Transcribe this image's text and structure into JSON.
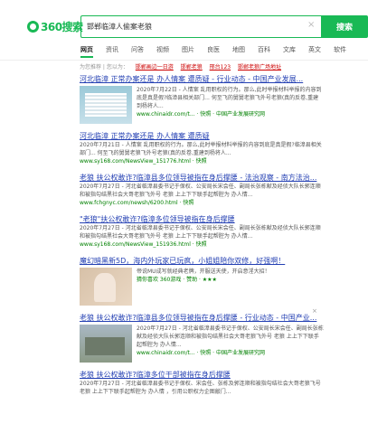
{
  "header": {
    "logo_text": "360搜索",
    "query": "邯郸临漳人偷案老狼",
    "clear_glyph": "×",
    "search_btn": "搜索"
  },
  "tabs": [
    "网页",
    "资讯",
    "问答",
    "视频",
    "图片",
    "良医",
    "地图",
    "百科",
    "文库",
    "英文",
    "软件"
  ],
  "recommend": {
    "label": "为您推荐 | 您以为：",
    "items": [
      "邯郸画边一日游",
      "邯郸老狼",
      "邢台123",
      "邯郸老狼广场地址"
    ]
  },
  "results": [
    {
      "title": "河北临漳 正常办案还是 办人情案 遭质疑 - 行业动态 - 中国产业发展...",
      "desc": "2020年7月22日 - 人情案 乱用职权的行为。那么,此时举报材料举报的内容到底是真是假?临漳县相关部门... 何至飞的舅舅老狼飞外号老狼(真的反卷,重建到杨将人...",
      "url": "www.chinaidr.com/t... · 快照 · 中国产业发展研究网"
    },
    {
      "title": "河北临漳 正常办案还是 办人情案 遭质疑",
      "desc": "2020年7月21日 - 人情案 乱用职权的行为。那么,此时举报材料举报的内容到底是真是假?临漳县相关部门... 何至飞的舅舅老狼飞外号老狼(真的反卷,重建到杨将人...",
      "url": "www.sy168.com/NewsView_151776.html · 快照"
    },
    {
      "title": "老狼 扶公权敢诈?临漳县多位领导被指在身后撑腰 - 法治观察 - 南方法治...",
      "desc": "2020年7月27日 - 河北省临漳县委书记于保权、公安局长宋会任、副局长张栋献及经侦大队长郭连顺和被指勾结黑社会大哥老狼飞外号 老狼 上上下下联手起帮腔为 办人情...",
      "url": "www.fchgnyc.com/newsh/6200.html · 快照"
    },
    {
      "title": "\"老狼\"扶公权敢诈?临漳多位领导被指在身后撑腰",
      "desc": "2020年7月27日 - 河北省临漳县委书记于保权、公安局长宋会任、副局长张栋献及经侦大队长郭连顺和被指勾结黑社会大哥老狼飞外号 老狼 上上下下联手起帮腔为 办人情...",
      "url": "www.sy168.com/NewsView_151936.html · 快照"
    },
    {
      "title": "魔幻暗黑新5D，海内外玩家已玩疯，小姐姐陪你双修，好强啊！",
      "desc": "帝说MU成写就经典老牌，开服送天使，开启意淫大招！",
      "url": "猜你喜欢 360游戏 · 赞助 · ★★★"
    },
    {
      "title": "老狼 扶公权敢诈?临漳县多位领导被指在身后撑腰 - 行业动态 - 中国产业...",
      "desc": "2020年7月27日 - 河北省临漳县委书记于保权、公安局长宋会任、副局长张栋献及经侦大队长郭连顺和被指勾结黑社会大哥老狼飞外号 老狼 上上下下联手起帮腔为 办人情...",
      "url": "www.chinaidr.com/t... · 快照 · 中国产业发展研究网"
    },
    {
      "title": "老狼 扶公权敢诈?临漳多位干部被指在身后撑腰",
      "desc": "2020年7月27日 - 河北省临漳县委书记于保权、宋会任、张栋及郭连顺和被指勾结社会大哥老狼飞号 老狼 上上下下联手起帮腔为 办人情 ，引用公职权力企图敲门...",
      "url": ""
    }
  ]
}
